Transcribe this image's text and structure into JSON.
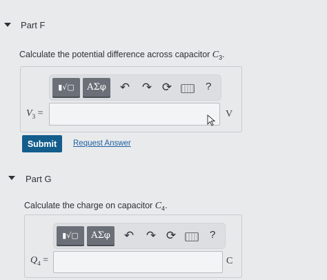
{
  "part_f": {
    "title": "Part F",
    "prompt_text": "Calculate the potential difference across capacitor ",
    "prompt_var": "C",
    "prompt_sub": "3",
    "prompt_end": ".",
    "toolbar": {
      "templates_label": "▮√▢",
      "symbols_label": "ΑΣφ",
      "help_label": "?"
    },
    "answer": {
      "var": "V",
      "sub": "3",
      "equals": "=",
      "value": "",
      "unit": "V"
    },
    "submit_label": "Submit",
    "request_answer_label": "Request Answer"
  },
  "part_g": {
    "title": "Part G",
    "prompt_text": "Calculate the charge on capacitor ",
    "prompt_var": "C",
    "prompt_sub": "4",
    "prompt_end": ".",
    "toolbar": {
      "templates_label": "▮√▢",
      "symbols_label": "ΑΣφ",
      "help_label": "?"
    },
    "answer": {
      "var": "Q",
      "sub": "4",
      "equals": "=",
      "value": "",
      "unit": "C"
    }
  }
}
